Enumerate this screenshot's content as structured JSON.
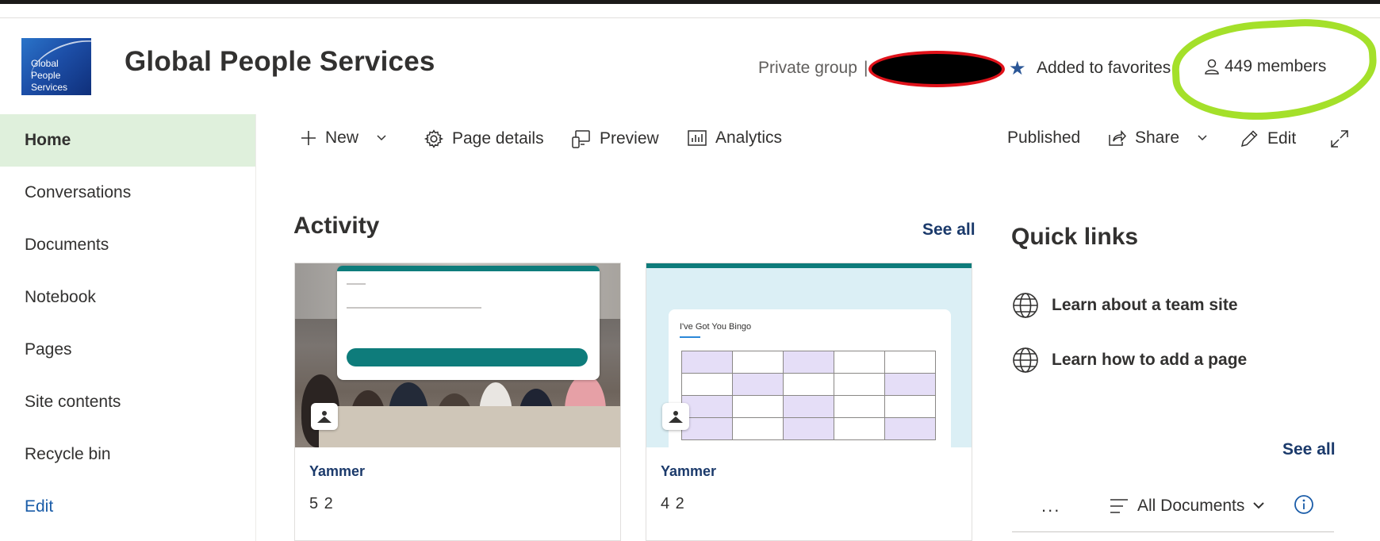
{
  "header": {
    "logo_lines": [
      "Global",
      "People",
      "Services"
    ],
    "site_title": "Global People Services",
    "privacy": "Private group",
    "separator": "|",
    "favorite_label": "Added to favorites",
    "members": "449 members"
  },
  "nav": {
    "items": [
      "Home",
      "Conversations",
      "Documents",
      "Notebook",
      "Pages",
      "Site contents",
      "Recycle bin"
    ],
    "edit": "Edit"
  },
  "commandbar": {
    "new": "New",
    "page_details": "Page details",
    "preview": "Preview",
    "analytics": "Analytics",
    "status": "Published",
    "share": "Share",
    "edit": "Edit"
  },
  "activity": {
    "title": "Activity",
    "see_all": "See all",
    "cards": [
      {
        "source": "Yammer",
        "counts": "5 2"
      },
      {
        "source": "Yammer",
        "counts": "4 2",
        "thumb_title": "I've Got You Bingo"
      }
    ]
  },
  "quick_links": {
    "title": "Quick links",
    "items": [
      "Learn about a team site",
      "Learn how to add a page"
    ],
    "see_all": "See all",
    "more": "...",
    "view": "All Documents"
  },
  "colors": {
    "nav_active_bg": "#dff0dc",
    "brand_navy": "#1b3a6b",
    "favorite_star": "#2b5797",
    "highlight": "#a4e02a",
    "redaction_border": "#e0121a"
  }
}
